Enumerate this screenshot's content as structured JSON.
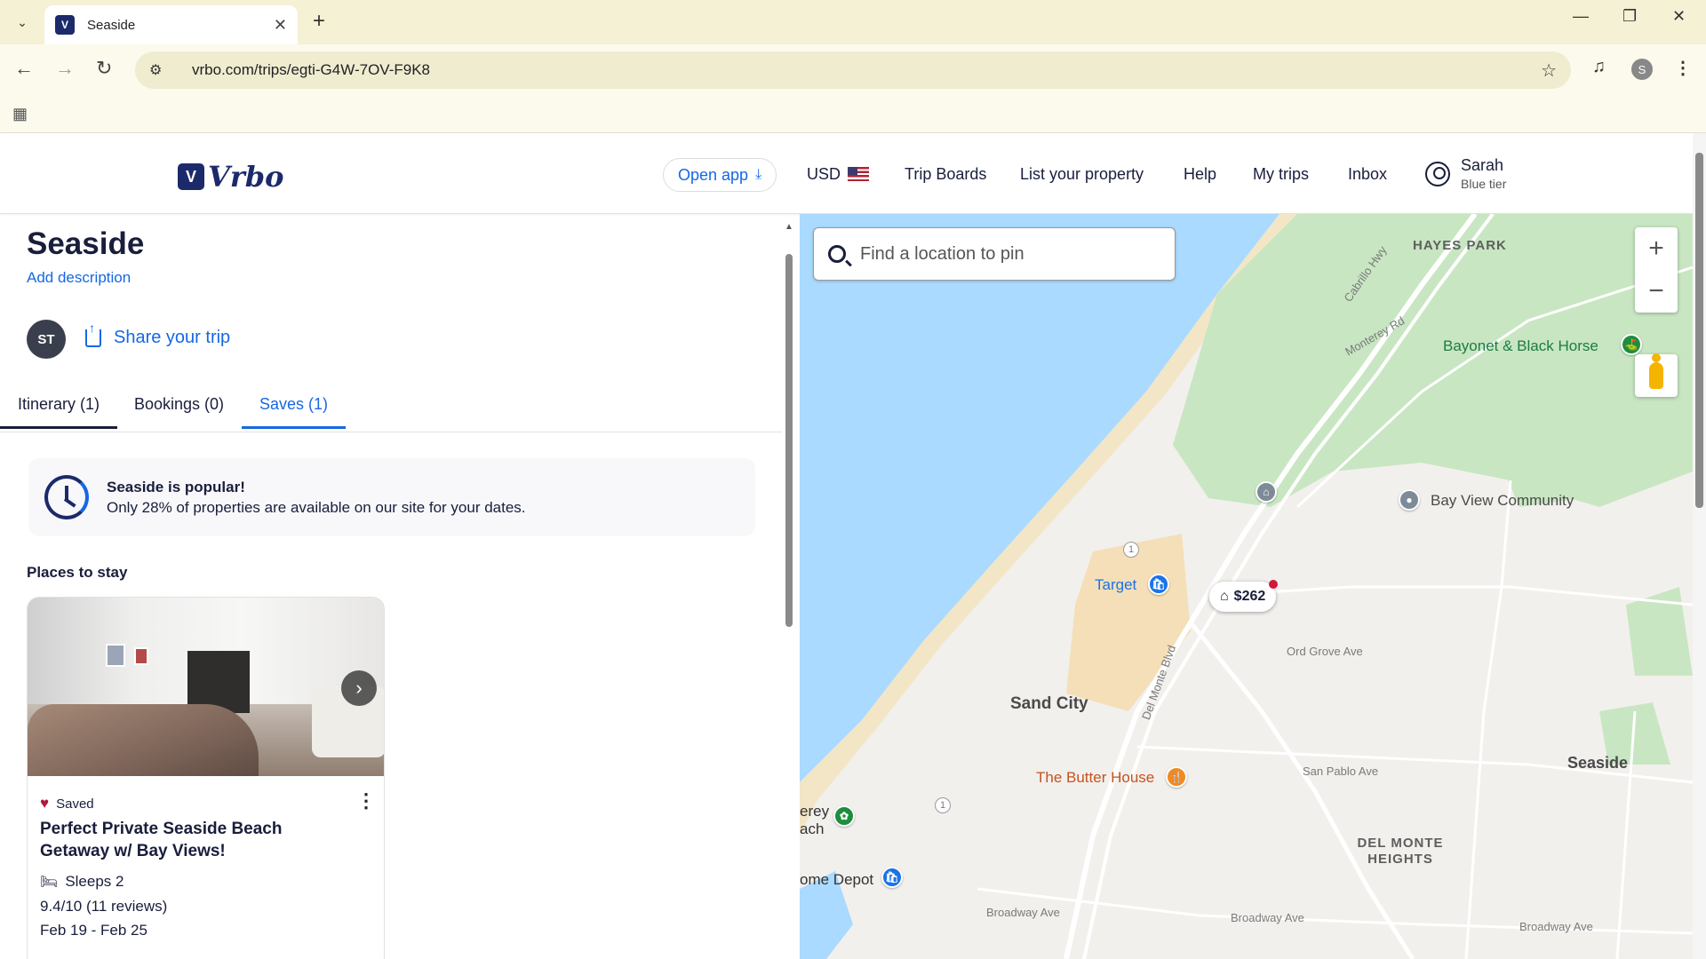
{
  "browser": {
    "tab_title": "Seaside",
    "url": "vrbo.com/trips/egti-G4W-7OV-F9K8",
    "profile_initial": "S"
  },
  "header": {
    "logo_text": "Vrbo",
    "open_app": "Open app",
    "currency": "USD",
    "nav": [
      "Trip Boards",
      "List your property",
      "Help",
      "My trips",
      "Inbox"
    ],
    "user_name": "Sarah",
    "user_tier": "Blue tier"
  },
  "trip": {
    "title": "Seaside",
    "add_description": "Add description",
    "member_initials": "ST",
    "share_label": "Share your trip",
    "tabs": [
      "Itinerary (1)",
      "Bookings (0)",
      "Saves (1)"
    ],
    "popular_heading": "Seaside is popular!",
    "popular_text": "Only 28% of properties are available on our site for your dates.",
    "places_title": "Places to stay"
  },
  "property": {
    "saved_label": "Saved",
    "name": "Perfect Private Seaside Beach Getaway w/ Bay Views!",
    "sleeps": "Sleeps 2",
    "rating": "9.4/10 (11 reviews)",
    "dates": "Feb 19 - Feb 25"
  },
  "map": {
    "search_placeholder": "Find a location to pin",
    "price_pin": "$262",
    "labels": {
      "hayes_park": "HAYES PARK",
      "bayonet": "Bayonet & Black Horse",
      "bay_view": "Bay View Community",
      "target": "Target",
      "sand_city": "Sand City",
      "butter_house": "The Butter House",
      "seaside": "Seaside",
      "del_monte_heights": "DEL MONTE HEIGHTS",
      "home_depot": "ome Depot",
      "monterey_edge": "erey\nach",
      "ord_grove": "Ord Grove Ave",
      "san_pablo": "San Pablo Ave",
      "broadway1": "Broadway Ave",
      "broadway2": "Broadway Ave",
      "broadway3": "Broadway Ave",
      "monterey_rd": "Monterey Rd",
      "cabrillo": "Cabrillo Hwy",
      "del_monte_blvd": "Del Monte Blvd",
      "hwy1a": "1",
      "hwy1b": "1"
    }
  },
  "colors": {
    "brand": "#1c2a6b",
    "link": "#1668e3",
    "water": "#aadaff",
    "park": "#c8e6c2"
  }
}
